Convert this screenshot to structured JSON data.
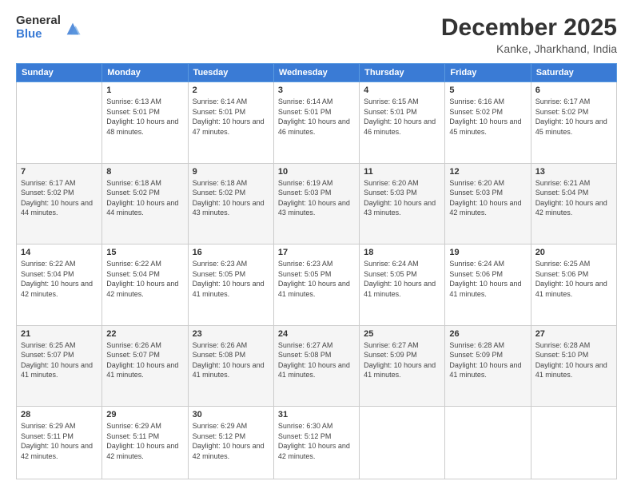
{
  "logo": {
    "general": "General",
    "blue": "Blue"
  },
  "title": "December 2025",
  "location": "Kanke, Jharkhand, India",
  "days_of_week": [
    "Sunday",
    "Monday",
    "Tuesday",
    "Wednesday",
    "Thursday",
    "Friday",
    "Saturday"
  ],
  "weeks": [
    [
      {
        "day": "",
        "sunrise": "",
        "sunset": "",
        "daylight": ""
      },
      {
        "day": "1",
        "sunrise": "Sunrise: 6:13 AM",
        "sunset": "Sunset: 5:01 PM",
        "daylight": "Daylight: 10 hours and 48 minutes."
      },
      {
        "day": "2",
        "sunrise": "Sunrise: 6:14 AM",
        "sunset": "Sunset: 5:01 PM",
        "daylight": "Daylight: 10 hours and 47 minutes."
      },
      {
        "day": "3",
        "sunrise": "Sunrise: 6:14 AM",
        "sunset": "Sunset: 5:01 PM",
        "daylight": "Daylight: 10 hours and 46 minutes."
      },
      {
        "day": "4",
        "sunrise": "Sunrise: 6:15 AM",
        "sunset": "Sunset: 5:01 PM",
        "daylight": "Daylight: 10 hours and 46 minutes."
      },
      {
        "day": "5",
        "sunrise": "Sunrise: 6:16 AM",
        "sunset": "Sunset: 5:02 PM",
        "daylight": "Daylight: 10 hours and 45 minutes."
      },
      {
        "day": "6",
        "sunrise": "Sunrise: 6:17 AM",
        "sunset": "Sunset: 5:02 PM",
        "daylight": "Daylight: 10 hours and 45 minutes."
      }
    ],
    [
      {
        "day": "7",
        "sunrise": "Sunrise: 6:17 AM",
        "sunset": "Sunset: 5:02 PM",
        "daylight": "Daylight: 10 hours and 44 minutes."
      },
      {
        "day": "8",
        "sunrise": "Sunrise: 6:18 AM",
        "sunset": "Sunset: 5:02 PM",
        "daylight": "Daylight: 10 hours and 44 minutes."
      },
      {
        "day": "9",
        "sunrise": "Sunrise: 6:18 AM",
        "sunset": "Sunset: 5:02 PM",
        "daylight": "Daylight: 10 hours and 43 minutes."
      },
      {
        "day": "10",
        "sunrise": "Sunrise: 6:19 AM",
        "sunset": "Sunset: 5:03 PM",
        "daylight": "Daylight: 10 hours and 43 minutes."
      },
      {
        "day": "11",
        "sunrise": "Sunrise: 6:20 AM",
        "sunset": "Sunset: 5:03 PM",
        "daylight": "Daylight: 10 hours and 43 minutes."
      },
      {
        "day": "12",
        "sunrise": "Sunrise: 6:20 AM",
        "sunset": "Sunset: 5:03 PM",
        "daylight": "Daylight: 10 hours and 42 minutes."
      },
      {
        "day": "13",
        "sunrise": "Sunrise: 6:21 AM",
        "sunset": "Sunset: 5:04 PM",
        "daylight": "Daylight: 10 hours and 42 minutes."
      }
    ],
    [
      {
        "day": "14",
        "sunrise": "Sunrise: 6:22 AM",
        "sunset": "Sunset: 5:04 PM",
        "daylight": "Daylight: 10 hours and 42 minutes."
      },
      {
        "day": "15",
        "sunrise": "Sunrise: 6:22 AM",
        "sunset": "Sunset: 5:04 PM",
        "daylight": "Daylight: 10 hours and 42 minutes."
      },
      {
        "day": "16",
        "sunrise": "Sunrise: 6:23 AM",
        "sunset": "Sunset: 5:05 PM",
        "daylight": "Daylight: 10 hours and 41 minutes."
      },
      {
        "day": "17",
        "sunrise": "Sunrise: 6:23 AM",
        "sunset": "Sunset: 5:05 PM",
        "daylight": "Daylight: 10 hours and 41 minutes."
      },
      {
        "day": "18",
        "sunrise": "Sunrise: 6:24 AM",
        "sunset": "Sunset: 5:05 PM",
        "daylight": "Daylight: 10 hours and 41 minutes."
      },
      {
        "day": "19",
        "sunrise": "Sunrise: 6:24 AM",
        "sunset": "Sunset: 5:06 PM",
        "daylight": "Daylight: 10 hours and 41 minutes."
      },
      {
        "day": "20",
        "sunrise": "Sunrise: 6:25 AM",
        "sunset": "Sunset: 5:06 PM",
        "daylight": "Daylight: 10 hours and 41 minutes."
      }
    ],
    [
      {
        "day": "21",
        "sunrise": "Sunrise: 6:25 AM",
        "sunset": "Sunset: 5:07 PM",
        "daylight": "Daylight: 10 hours and 41 minutes."
      },
      {
        "day": "22",
        "sunrise": "Sunrise: 6:26 AM",
        "sunset": "Sunset: 5:07 PM",
        "daylight": "Daylight: 10 hours and 41 minutes."
      },
      {
        "day": "23",
        "sunrise": "Sunrise: 6:26 AM",
        "sunset": "Sunset: 5:08 PM",
        "daylight": "Daylight: 10 hours and 41 minutes."
      },
      {
        "day": "24",
        "sunrise": "Sunrise: 6:27 AM",
        "sunset": "Sunset: 5:08 PM",
        "daylight": "Daylight: 10 hours and 41 minutes."
      },
      {
        "day": "25",
        "sunrise": "Sunrise: 6:27 AM",
        "sunset": "Sunset: 5:09 PM",
        "daylight": "Daylight: 10 hours and 41 minutes."
      },
      {
        "day": "26",
        "sunrise": "Sunrise: 6:28 AM",
        "sunset": "Sunset: 5:09 PM",
        "daylight": "Daylight: 10 hours and 41 minutes."
      },
      {
        "day": "27",
        "sunrise": "Sunrise: 6:28 AM",
        "sunset": "Sunset: 5:10 PM",
        "daylight": "Daylight: 10 hours and 41 minutes."
      }
    ],
    [
      {
        "day": "28",
        "sunrise": "Sunrise: 6:29 AM",
        "sunset": "Sunset: 5:11 PM",
        "daylight": "Daylight: 10 hours and 42 minutes."
      },
      {
        "day": "29",
        "sunrise": "Sunrise: 6:29 AM",
        "sunset": "Sunset: 5:11 PM",
        "daylight": "Daylight: 10 hours and 42 minutes."
      },
      {
        "day": "30",
        "sunrise": "Sunrise: 6:29 AM",
        "sunset": "Sunset: 5:12 PM",
        "daylight": "Daylight: 10 hours and 42 minutes."
      },
      {
        "day": "31",
        "sunrise": "Sunrise: 6:30 AM",
        "sunset": "Sunset: 5:12 PM",
        "daylight": "Daylight: 10 hours and 42 minutes."
      },
      {
        "day": "",
        "sunrise": "",
        "sunset": "",
        "daylight": ""
      },
      {
        "day": "",
        "sunrise": "",
        "sunset": "",
        "daylight": ""
      },
      {
        "day": "",
        "sunrise": "",
        "sunset": "",
        "daylight": ""
      }
    ]
  ]
}
